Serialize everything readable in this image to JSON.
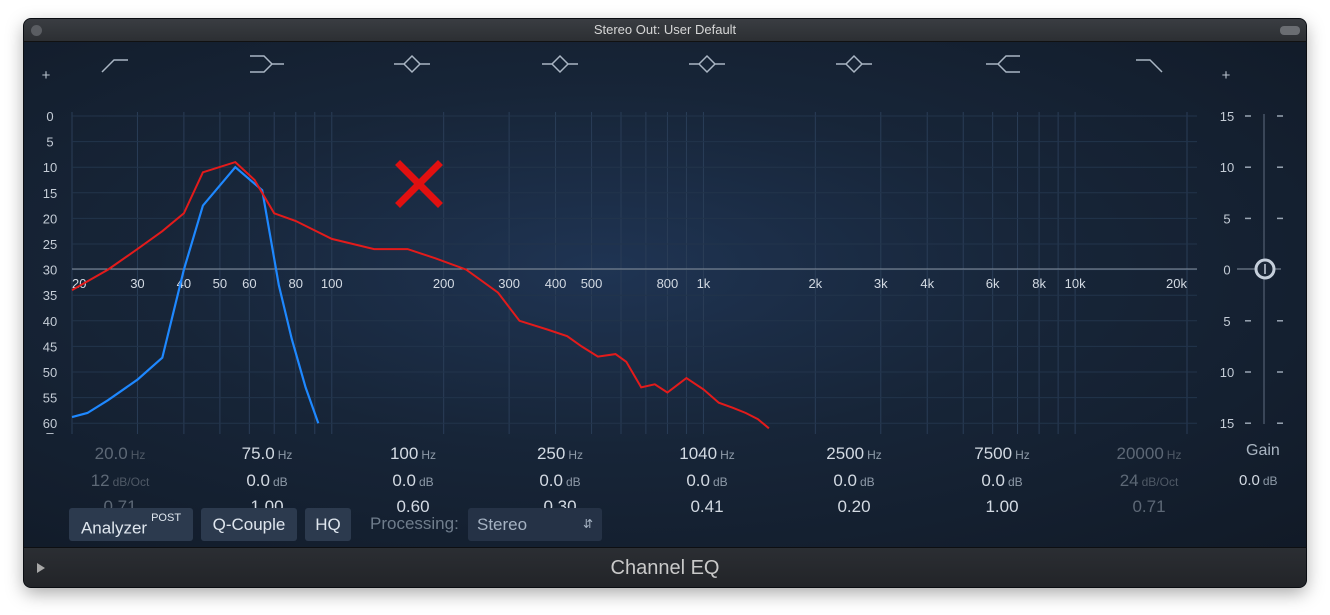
{
  "window": {
    "title": "Stereo Out: User Default",
    "plugin_name": "Channel EQ"
  },
  "scales": {
    "analyzer_db": [
      "0",
      "5",
      "10",
      "15",
      "20",
      "25",
      "30",
      "35",
      "40",
      "45",
      "50",
      "55",
      "60"
    ],
    "eq_gain": [
      "15",
      "10",
      "5",
      "0",
      "5",
      "10",
      "15"
    ],
    "frequencies": [
      "20",
      "30",
      "40",
      "50",
      "60",
      "80",
      "100",
      "200",
      "300",
      "400",
      "500",
      "800",
      "1k",
      "2k",
      "3k",
      "4k",
      "6k",
      "8k",
      "10k",
      "20k"
    ]
  },
  "bands": [
    {
      "freq": "20.0",
      "freq_unit": "Hz",
      "gain": "12",
      "gain_unit": "dB/Oct",
      "q": "0.71",
      "enabled": false,
      "icon": "low-cut-icon"
    },
    {
      "freq": "75.0",
      "freq_unit": "Hz",
      "gain": "0.0",
      "gain_unit": "dB",
      "q": "1.00",
      "enabled": true,
      "icon": "low-shelf-icon"
    },
    {
      "freq": "100",
      "freq_unit": "Hz",
      "gain": "0.0",
      "gain_unit": "dB",
      "q": "0.60",
      "enabled": true,
      "icon": "parametric-bell-icon"
    },
    {
      "freq": "250",
      "freq_unit": "Hz",
      "gain": "0.0",
      "gain_unit": "dB",
      "q": "0.30",
      "enabled": true,
      "icon": "parametric-bell-icon"
    },
    {
      "freq": "1040",
      "freq_unit": "Hz",
      "gain": "0.0",
      "gain_unit": "dB",
      "q": "0.41",
      "enabled": true,
      "icon": "parametric-bell-icon"
    },
    {
      "freq": "2500",
      "freq_unit": "Hz",
      "gain": "0.0",
      "gain_unit": "dB",
      "q": "0.20",
      "enabled": true,
      "icon": "parametric-bell-icon"
    },
    {
      "freq": "7500",
      "freq_unit": "Hz",
      "gain": "0.0",
      "gain_unit": "dB",
      "q": "1.00",
      "enabled": true,
      "icon": "high-shelf-icon"
    },
    {
      "freq": "20000",
      "freq_unit": "Hz",
      "gain": "24",
      "gain_unit": "dB/Oct",
      "q": "0.71",
      "enabled": false,
      "icon": "high-cut-icon"
    }
  ],
  "gain": {
    "label": "Gain",
    "value": "0.0",
    "unit": "dB"
  },
  "controls": {
    "analyzer_label": "Analyzer",
    "analyzer_mode": "POST",
    "q_couple_label": "Q-Couple",
    "hq_label": "HQ",
    "processing_label": "Processing:",
    "processing_value": "Stereo"
  },
  "plus_sign": "+",
  "curves": {
    "red_color": "#e31b1b",
    "blue_color": "#1e88ff",
    "marker_color": "#e11010",
    "marker_icon": "x-mark-icon"
  }
}
